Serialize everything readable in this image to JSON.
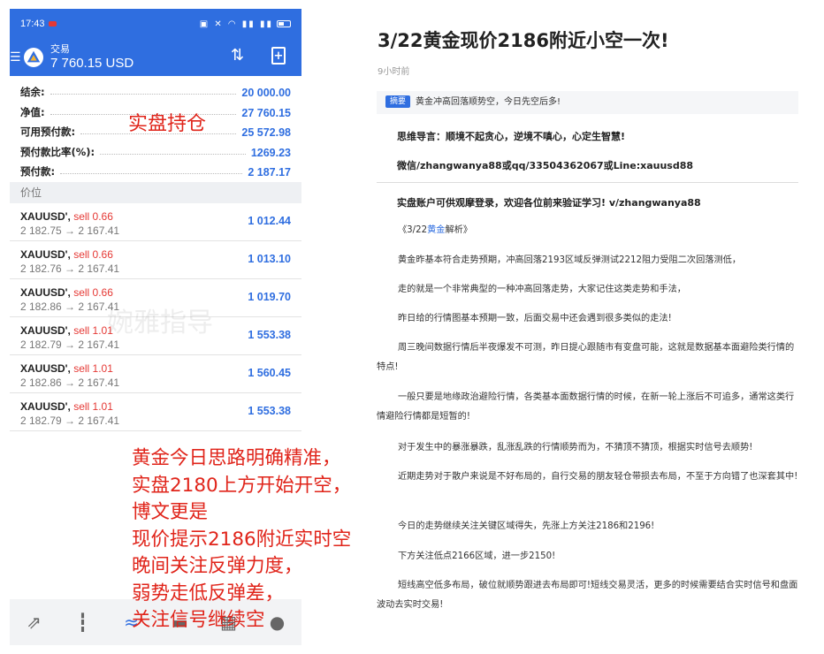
{
  "phone": {
    "status_time": "17:43",
    "app_title": "交易",
    "balance_display": "7 760.15 USD",
    "account": [
      {
        "label": "结余:",
        "value": "20 000.00"
      },
      {
        "label": "净值:",
        "value": "27 760.15"
      },
      {
        "label": "可用预付款:",
        "value": "25 572.98"
      },
      {
        "label": "预付款比率(%):",
        "value": "1269.23"
      },
      {
        "label": "预付款:",
        "value": "2 187.17"
      }
    ],
    "section_label": "价位",
    "positions": [
      {
        "symbol": "XAUUSD',",
        "side": " sell 0.66",
        "prices": "2 182.75 → 2 167.41",
        "pl": "1 012.44"
      },
      {
        "symbol": "XAUUSD',",
        "side": " sell 0.66",
        "prices": "2 182.76 → 2 167.41",
        "pl": "1 013.10"
      },
      {
        "symbol": "XAUUSD',",
        "side": " sell 0.66",
        "prices": "2 182.86 → 2 167.41",
        "pl": "1 019.70"
      },
      {
        "symbol": "XAUUSD',",
        "side": " sell 1.01",
        "prices": "2 182.79 → 2 167.41",
        "pl": "1 553.38"
      },
      {
        "symbol": "XAUUSD',",
        "side": " sell 1.01",
        "prices": "2 182.86 → 2 167.41",
        "pl": "1 560.45"
      },
      {
        "symbol": "XAUUSD',",
        "side": " sell 1.01",
        "prices": "2 182.79 → 2 167.41",
        "pl": "1 553.38"
      }
    ],
    "tabs": [
      "quotes-icon",
      "chart-icon",
      "trade-icon",
      "history-icon",
      "news-icon",
      "messages-icon"
    ],
    "accent_color": "#2f6ee0",
    "loss_color": "#e53935"
  },
  "overlay": {
    "label_real": "实盘持仓",
    "watermark": "婉雅指导",
    "notes": [
      "黄金今日思路明确精准，",
      "实盘2180上方开始开空，",
      "博文更是",
      "现价提示2186附近实时空",
      "晚间关注反弹力度，",
      "弱势走低反弹差，",
      "关注信号继续空"
    ],
    "note_color": "#e0241a"
  },
  "article": {
    "title": "3/22黄金现价2186附近小空一次!",
    "time": "9小时前",
    "summary_tag": "摘要",
    "summary_text": "黄金冲高回落顺势空，今日先空后多!",
    "motto": "思维导言：顺境不起贪心，逆境不嗔心，心定生智慧!",
    "contact": "微信/zhangwanya88或qq/3350436206​7或Line:xauusd88",
    "live_account": "实盘账户可供观摩登录，欢迎各位前来验证学习!  v/zhangwanya88",
    "analysis_prefix": "《3/22",
    "analysis_link": "黄金",
    "analysis_suffix": "解析》",
    "paragraphs": [
      "黄金昨基本符合走势预期，冲高回落2193区域反弹测试2212阻力受阻二次回落测低，",
      "走的就是一个非常典型的一种冲高回落走势，大家记住这类走势和手法，",
      "昨日给的行情图基本预期一致，后面交易中还会遇到很多类似的走法!",
      "周三晚间数据行情后半夜爆发不可测，昨日提心跟随市有变盘可能，这就是数据基本面避险类行情的特点!",
      "一般只要是地缘政治避险行情，各类基本面数据行情的时候，在新一轮上涨后不可追多，通常这类行情避险行情都是短暂的!",
      "对于发生中的暴涨暴跌，乱涨乱跌的行情顺势而为，不猜顶不猜顶，根据实时信号去顺势!",
      "近期走势对于散户来说是不好布局的，自行交易的朋友轻仓带损去布局，不至于方向错了也深套其中!",
      "今日的走势继续关注关键区域得失，先涨上方关注2186和2196!",
      "下方关注低点2166区域，进一步2150!",
      "短线高空低多布局，破位就顺势跟进去布局即可!短线交易灵活，更多的时候需要结合实时信号和盘面波动去实时交易!"
    ]
  }
}
